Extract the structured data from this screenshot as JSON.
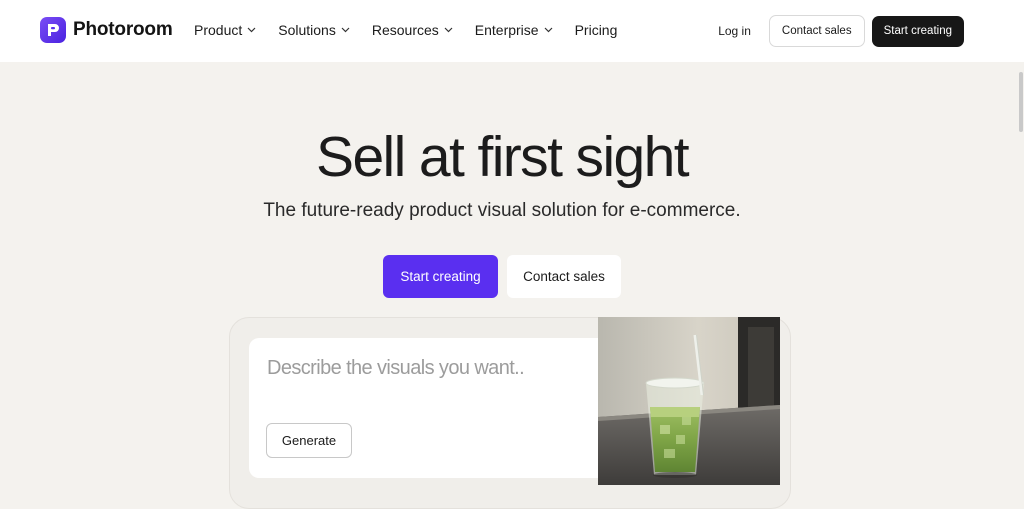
{
  "brand": {
    "name": "Photoroom",
    "accent": "#5a2ff0"
  },
  "nav": {
    "items": [
      {
        "label": "Product",
        "has_dropdown": true
      },
      {
        "label": "Solutions",
        "has_dropdown": true
      },
      {
        "label": "Resources",
        "has_dropdown": true
      },
      {
        "label": "Enterprise",
        "has_dropdown": true
      },
      {
        "label": "Pricing",
        "has_dropdown": false
      }
    ],
    "login_label": "Log in",
    "contact_label": "Contact sales",
    "start_label": "Start creating"
  },
  "hero": {
    "title": "Sell at first sight",
    "subtitle": "The future-ready product visual solution for e-commerce.",
    "primary_cta": "Start creating",
    "secondary_cta": "Contact sales"
  },
  "demo": {
    "placeholder": "Describe the visuals you want..",
    "generate_label": "Generate",
    "image_icon": "iced-matcha-latte-photo"
  }
}
